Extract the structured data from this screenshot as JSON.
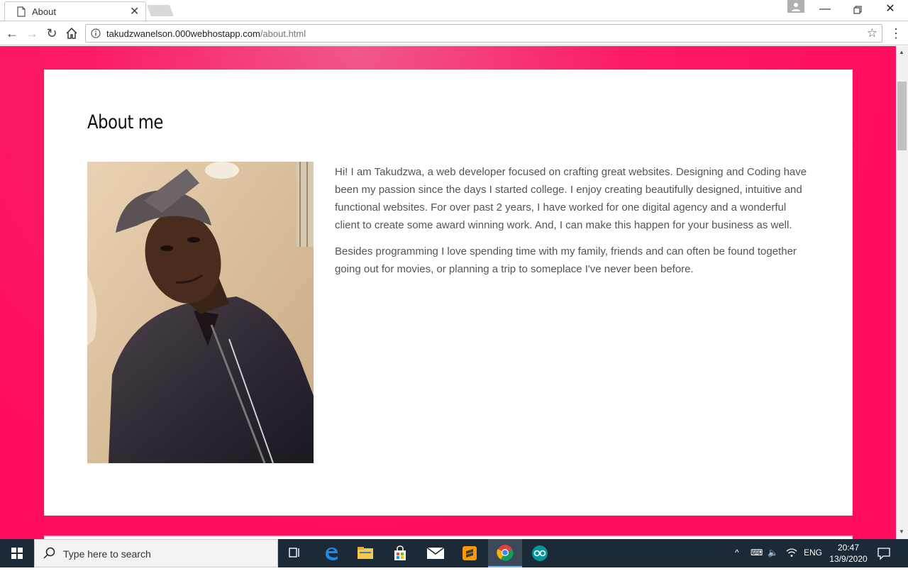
{
  "tab": {
    "title": "About"
  },
  "toolbar": {
    "url_host": "takudzwanelson.000webhostapp.com",
    "url_path": "/about.html"
  },
  "page": {
    "heading": "About me",
    "bio_paragraph_1": "Hi! I am Takudzwa, a web developer focused on crafting great websites. Designing and Coding have been my passion since the days I started college. I enjoy creating beautifully designed, intuitive and functional websites. For over past 2 years, I have worked for one digital agency and a wonderful client to create some award winning work. And, I can make this happen for your business as well.",
    "bio_paragraph_2": "Besides programming I love spending time with my family, friends and can often be found together going out for movies, or planning a trip to someplace I've never been before."
  },
  "taskbar": {
    "search_placeholder": "Type here to search",
    "language": "ENG",
    "time": "20:47",
    "date": "13/9/2020"
  },
  "colors": {
    "page_background": "#ff0e5d",
    "card": "#ffffff",
    "taskbar": "#1c2a38"
  }
}
